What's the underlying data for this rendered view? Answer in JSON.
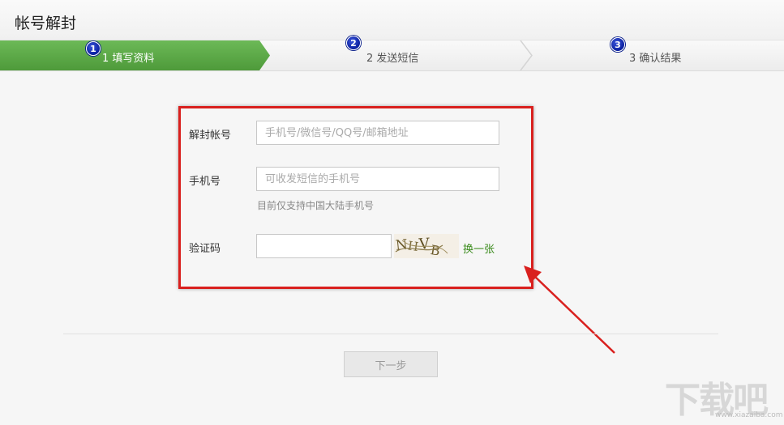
{
  "page": {
    "title": "帐号解封"
  },
  "steps": [
    {
      "badge": "1",
      "label": "1 填写资料",
      "active": true
    },
    {
      "badge": "2",
      "label": "2 发送短信",
      "active": false
    },
    {
      "badge": "3",
      "label": "3 确认结果",
      "active": false
    }
  ],
  "form": {
    "account": {
      "label": "解封帐号",
      "placeholder": "手机号/微信号/QQ号/邮箱地址",
      "value": ""
    },
    "phone": {
      "label": "手机号",
      "placeholder": "可收发短信的手机号",
      "value": "",
      "hint": "目前仅支持中国大陆手机号"
    },
    "captcha": {
      "label": "验证码",
      "value": "",
      "image_text": "NHVB",
      "refresh_label": "换一张"
    }
  },
  "actions": {
    "next_label": "下一步"
  },
  "watermark": {
    "text": "下载吧",
    "url": "www.xiazaiba.com"
  },
  "colors": {
    "active_step": "#5aa845",
    "highlight_box": "#d9201e",
    "arrow": "#d9201e",
    "link": "#3a8b1c",
    "badge": "#0a1fa0"
  }
}
